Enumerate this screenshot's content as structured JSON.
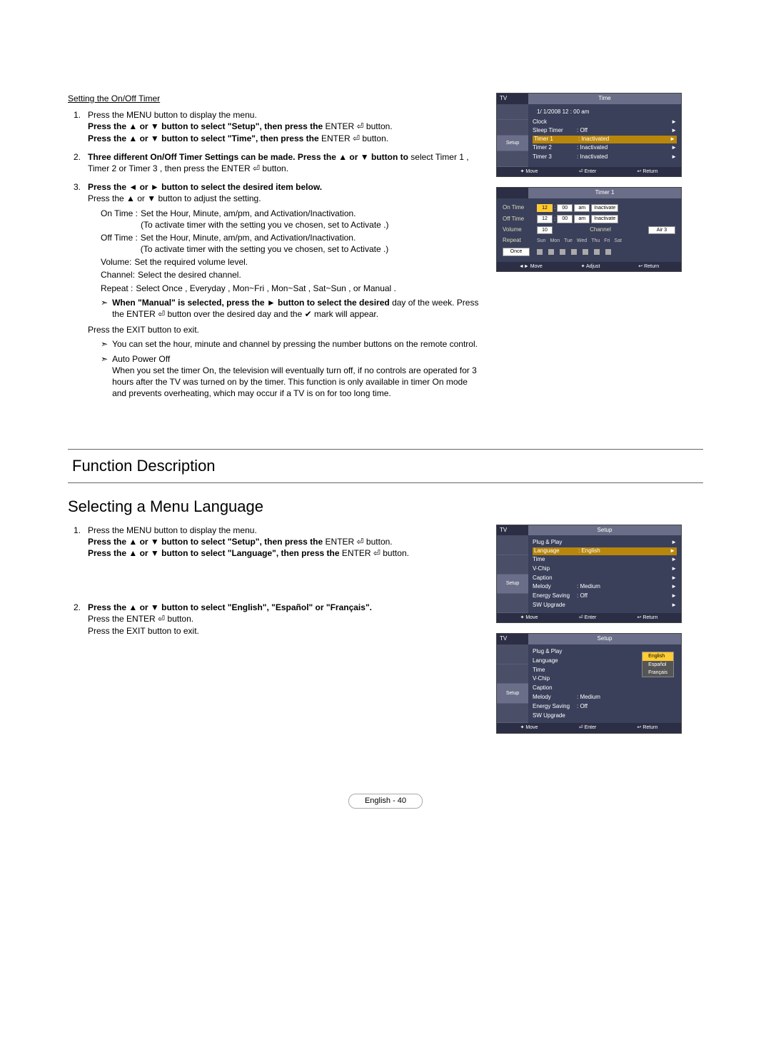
{
  "section1": {
    "subtitle": "Setting the On/Off Timer",
    "steps": [
      {
        "num": "1.",
        "text1": "Press the MENU button to display the menu.",
        "text2_pre": "Press the ▲ or ▼ button to select \"Setup\", then press the ",
        "text2_post": "ENTER ⏎ button.",
        "text3_pre": "Press the ▲ or ▼ button to select \"Time\", then press the ",
        "text3_post": "ENTER ⏎ button."
      },
      {
        "num": "2.",
        "bold": "Three different On/Off Timer Settings can be made. Press the ▲ or ▼ button to ",
        "rest": "select Timer 1 , Timer 2 or Timer 3 , then press the  ENTER ⏎ button."
      },
      {
        "num": "3.",
        "bold": "Press the ◄ or ► button to select the desired item below.",
        "line2": "Press the ▲ or ▼ button to adjust the setting.",
        "defs": [
          {
            "t": "On Time :",
            "d": "Set the Hour, Minute, am/pm, and Activation/Inactivation.\n(To activate timer with the setting you ve chosen, set to Activate .)"
          },
          {
            "t": "Off Time :",
            "d": "Set the Hour, Minute, am/pm, and Activation/Inactivation.\n(To activate timer with the setting you ve chosen, set to Activate .)"
          },
          {
            "t": "Volume:",
            "d": "Set the required volume level."
          },
          {
            "t": "Channel:",
            "d": "Select the desired channel."
          },
          {
            "t": "Repeat :",
            "d": "Select  Once ,  Everyday ,  Mon~Fri ,  Mon~Sat ,  Sat~Sun , or Manual ."
          }
        ],
        "manual_note_bold": "When \"Manual\" is selected, press the ► button to select the desired ",
        "manual_note_rest": "day of the week. Press the ENTER ⏎ button over the desired day and the ✔ mark will appear.",
        "exit": "Press the EXIT button to exit.",
        "notes": [
          "You can set the hour, minute and channel by pressing the number buttons on the remote control.",
          "Auto Power Off\nWhen you set the timer On, the television will eventually turn off, if no controls are operated for 3 hours after the TV was turned on by the timer. This function is only available in timer On mode and prevents overheating, which may occur if a TV is on for too long time."
        ]
      }
    ]
  },
  "osd_time": {
    "tv": "TV",
    "title": "Time",
    "datetime": "1/ 1/2008 12 : 00 am",
    "rows": [
      {
        "l": "Clock",
        "v": "",
        "a": "►"
      },
      {
        "l": "Sleep Timer",
        "v": ": Off",
        "a": "►"
      },
      {
        "l": "Timer 1",
        "v": ": Inactivated",
        "a": "►",
        "hi": true
      },
      {
        "l": "Timer 2",
        "v": ": Inactivated",
        "a": "►"
      },
      {
        "l": "Timer 3",
        "v": ": Inactivated",
        "a": "►"
      }
    ],
    "sidebar_active": "Setup",
    "foot": [
      "✦ Move",
      "⏎ Enter",
      "↩ Return"
    ]
  },
  "osd_timer1": {
    "title": "Timer 1",
    "on_label": "On Time",
    "off_label": "Off Time",
    "on": {
      "h": "12",
      "m": "00",
      "ampm": "am",
      "act": "Inactivate"
    },
    "off": {
      "h": "12",
      "m": "00",
      "ampm": "am",
      "act": "Inactivate"
    },
    "vol_label": "Volume",
    "ch_label": "Channel",
    "vol": "10",
    "channel": "Air 3",
    "repeat_label": "Repeat",
    "repeat_value": "Once",
    "days": [
      "Sun",
      "Mon",
      "Tue",
      "Wed",
      "Thu",
      "Fri",
      "Sat"
    ],
    "foot": [
      "◄► Move",
      "✦ Adjust",
      "↩ Return"
    ]
  },
  "section2": {
    "heading": "Function Description",
    "subheading": "Selecting a Menu Language",
    "steps": [
      {
        "num": "1.",
        "l1": "Press the MENU button to display the menu.",
        "l2_pre": "Press the ▲ or ▼ button to select \"Setup\", then press the ",
        "l2_post": "ENTER ⏎ button.",
        "l3_pre": "Press the ▲ or ▼ button to select \"Language\", then press the ",
        "l3_post": "ENTER ⏎ button."
      },
      {
        "num": "2.",
        "bold": "Press the ▲ or ▼ button to select \"English\", \"Español\" or \"Français\".",
        "l2": "Press the ENTER ⏎ button.",
        "l3": "Press the EXIT button to exit."
      }
    ]
  },
  "osd_setup1": {
    "tv": "TV",
    "title": "Setup",
    "rows": [
      {
        "l": "Plug & Play",
        "v": "",
        "a": "►"
      },
      {
        "l": "Language",
        "v": ": English",
        "a": "►",
        "hi": true
      },
      {
        "l": "Time",
        "v": "",
        "a": "►"
      },
      {
        "l": "V-Chip",
        "v": "",
        "a": "►"
      },
      {
        "l": "Caption",
        "v": "",
        "a": "►"
      },
      {
        "l": "Melody",
        "v": ": Medium",
        "a": "►"
      },
      {
        "l": "Energy Saving",
        "v": ": Off",
        "a": "►"
      },
      {
        "l": "SW Upgrade",
        "v": "",
        "a": "►"
      }
    ],
    "sidebar_active": "Setup",
    "foot": [
      "✦ Move",
      "⏎ Enter",
      "↩ Return"
    ]
  },
  "osd_setup2": {
    "tv": "TV",
    "title": "Setup",
    "rows": [
      {
        "l": "Plug & Play",
        "v": ""
      },
      {
        "l": "Language",
        "v": ""
      },
      {
        "l": "Time",
        "v": ""
      },
      {
        "l": "V-Chip",
        "v": ""
      },
      {
        "l": "Caption",
        "v": ""
      },
      {
        "l": "Melody",
        "v": ": Medium"
      },
      {
        "l": "Energy Saving",
        "v": ": Off"
      },
      {
        "l": "SW Upgrade",
        "v": ""
      }
    ],
    "popup": [
      "English",
      "Español",
      "Français"
    ],
    "popup_selected": "English",
    "sidebar_active": "Setup",
    "foot": [
      "✦ Move",
      "⏎ Enter",
      "↩ Return"
    ]
  },
  "footer": "English - 40"
}
